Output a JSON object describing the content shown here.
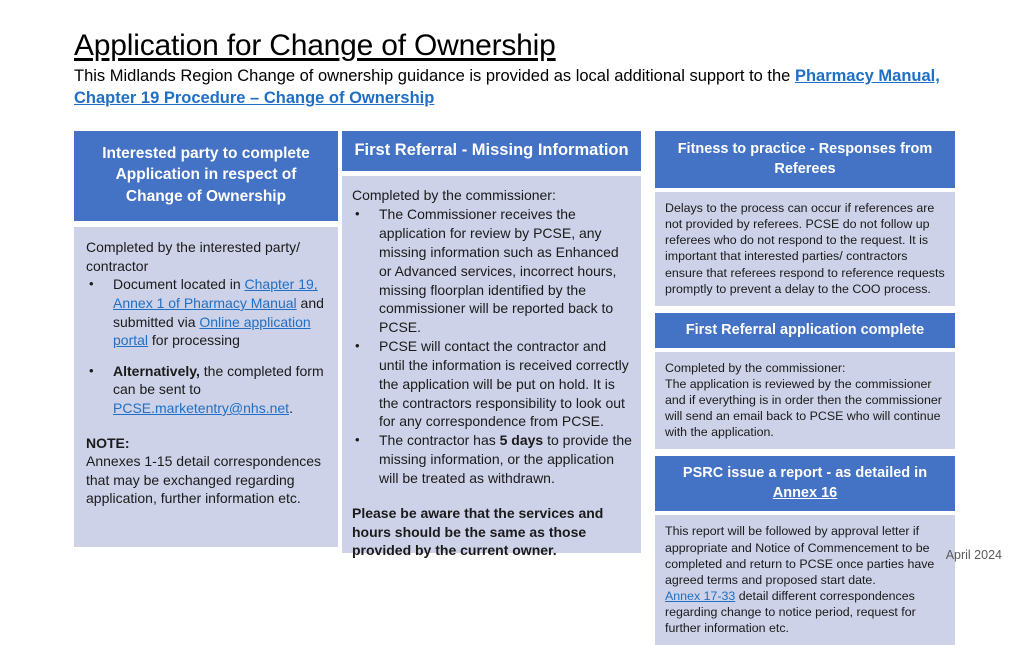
{
  "header": {
    "title": "Application for Change of Ownership",
    "subtitle_prefix": "This Midlands Region Change of ownership guidance is provided as local additional support to the ",
    "subtitle_link": "Pharmacy Manual, Chapter 19 Procedure – Change of Ownership"
  },
  "colors": {
    "header_blue": "#4472C4",
    "body_lavender": "#CDD2E8",
    "link_blue": "#1F6FC4",
    "text_black": "#000000"
  },
  "columns": {
    "col1": {
      "header": "Interested party to complete Application in respect of Change of Ownership",
      "intro": "Completed by the interested party/ contractor",
      "bullet1": {
        "pre": "Document located in ",
        "link1": "Chapter 19, Annex 1 of Pharmacy Manual",
        "mid": " and submitted via ",
        "link2": "Online application portal",
        "post": " for processing"
      },
      "bullet2": {
        "bold": "Alternatively,",
        "pre": " the completed form can be sent to ",
        "link": "PCSE.marketentry@nhs.net",
        "post": "."
      },
      "note_label": "NOTE:",
      "note_text": "Annexes 1-15 detail correspondences that may be exchanged regarding application, further information etc."
    },
    "col2": {
      "header": "First Referral - Missing Information",
      "intro": "Completed by the commissioner:",
      "bullets": [
        "The Commissioner receives the application for review by PCSE, any missing information such as Enhanced or Advanced services, incorrect hours, missing floorplan identified by the commissioner will be reported back to PCSE.",
        "PCSE will contact the contractor and until the information is received correctly the application will be put on hold. It is the contractors responsibility to look out for any correspondence from PCSE."
      ],
      "bullet3": {
        "pre": "The contractor has ",
        "bold": "5 days",
        "post": " to provide the missing information, or the application will be treated as withdrawn."
      },
      "closing": "Please be aware that the services and hours should be the same as those provided by the current owner."
    },
    "col3": {
      "box1": {
        "header": "Fitness to practice - Responses from Referees",
        "body": "Delays to the process can occur if references are not provided by referees.  PCSE do not follow up referees who do not respond to the request. It is important that interested parties/ contractors ensure that referees respond to reference requests promptly to prevent a delay to the COO process."
      },
      "box2": {
        "header": "First Referral application complete",
        "line1": "Completed by the commissioner:",
        "line2": "The application is reviewed by the commissioner and if everything is in order then the commissioner will send an email back to PCSE who will continue with the application."
      },
      "box3": {
        "header_pre": "PSRC issue a report - as detailed in ",
        "header_link": "Annex 16",
        "para1": "This report will be followed by approval letter if appropriate and Notice of Commencement to be completed and return to PCSE once parties have agreed terms and proposed start date.",
        "para2_link": "Annex 17-33",
        "para2_post": " detail different correspondences regarding change to notice period, request for further information etc."
      }
    }
  },
  "footer": {
    "date": "April 2024"
  }
}
